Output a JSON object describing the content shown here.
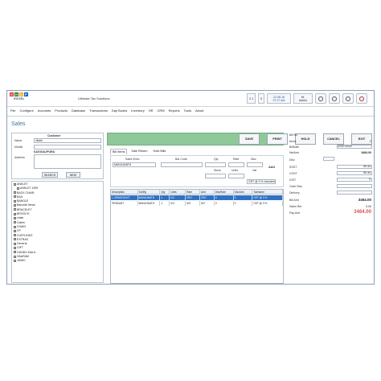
{
  "app": {
    "company": "Ultimate Tax Solutions",
    "logo_letters": [
      "S",
      "H",
      "O",
      "P"
    ],
    "logo_sub": "EXCEL",
    "logo_colors": [
      "#e23a2f",
      "#2e7d32",
      "#f9a825",
      "#1565c0"
    ],
    "accent": "#3d6fa8",
    "green": "#8fc99a",
    "datetime_line1": "22-08-18",
    "datetime_line2": "07:17 AM",
    "user_line1": "Hi,",
    "user_line2": "Admin",
    "small_buttons": [
      "2.1",
      "5"
    ],
    "icons": [
      "gear-icon",
      "circle-icon",
      "clock-icon",
      "power-icon"
    ]
  },
  "menu": [
    "File",
    "Configure",
    "Accounts",
    "Products",
    "Database",
    "Transactions",
    "Day Books",
    "Inventory",
    "HR",
    "CRM",
    "Reports",
    "Tools",
    "About"
  ],
  "page": {
    "title": "Sales"
  },
  "customer": {
    "header": "Customer",
    "name_label": "Name",
    "name_value": "vikale",
    "mobile_label": "Mobile",
    "city": "KAGGALIPURA",
    "address_label": "Address",
    "search_btn": "SEARCH",
    "new_btn": "NEW"
  },
  "tree": [
    "ANKLET",
    "ANKLET 1999",
    "BACK CHAIN",
    "BAJI",
    "BANGLE",
    "Barcode Items",
    "BRACELET",
    "BROOCH",
    "chain",
    "Cakes",
    "CHAIN",
    "CP",
    "CUFFLINKS",
    "EXTRAS",
    "General",
    "GIFT",
    "GUNDU MALA",
    "HAARAM",
    "JUMKI"
  ],
  "actions": [
    "SAVE",
    "PRINT",
    "HOLD",
    "CANCEL",
    "EXIT"
  ],
  "tabs": [
    "Bill Items",
    "Sale Return",
    "Hold Bills"
  ],
  "entry": {
    "exec_label": "Sales Exec",
    "exec_value": "MANJUNATH",
    "barcode_label": "Bar Code",
    "qty_label": "Qty",
    "rate_label": "Rate",
    "disc_label": "Disc",
    "stock_label": "Stock",
    "units_label": "Units",
    "vat_label": "Vat",
    "gst_value": "GST @ 3 % Included",
    "add_btn": "Add"
  },
  "grid": {
    "columns": [
      "Description",
      "ScrtBy",
      "Qty",
      "Units",
      "Rate",
      "Amt",
      "DiscRate",
      "DiscAmt",
      "TaxName"
    ],
    "rows": [
      [
        "1, BRASCELET",
        "MANJUNATH",
        "1",
        "KG",
        "2917",
        "2917",
        "0",
        "0",
        "GST @ 3 %"
      ],
      [
        "PENDANT",
        "MANJUNATH",
        "1",
        "KG",
        "547",
        "547",
        "0",
        "0",
        "GST @ 3 %"
      ]
    ]
  },
  "summary": {
    "bill_no_label": "Bill No",
    "items_label": "Items",
    "items_value": "2",
    "billdate_label": "BillDate",
    "billdate_value": "22/07/2018",
    "netamt_label": "NetAmt",
    "netamt_value": "3464.00",
    "disc_label": "Disc",
    "sgst_label": "SGST",
    "sgst_value": "50.44",
    "cgst_label": "CGST",
    "cgst_value": "50.44",
    "igst_label": "IGST",
    "igst_value": "0",
    "cashdisc_label": "Cash Disc",
    "delivery_label": "Delivery",
    "billamt_label": "Bill Amt",
    "billamt_value": "3464.00",
    "salesret_label": "Sales Ret",
    "salesret_value": "0.00",
    "payamt_label": "Pay Amt",
    "payamt_value": "3464.00",
    "pay_color": "#e05050"
  }
}
